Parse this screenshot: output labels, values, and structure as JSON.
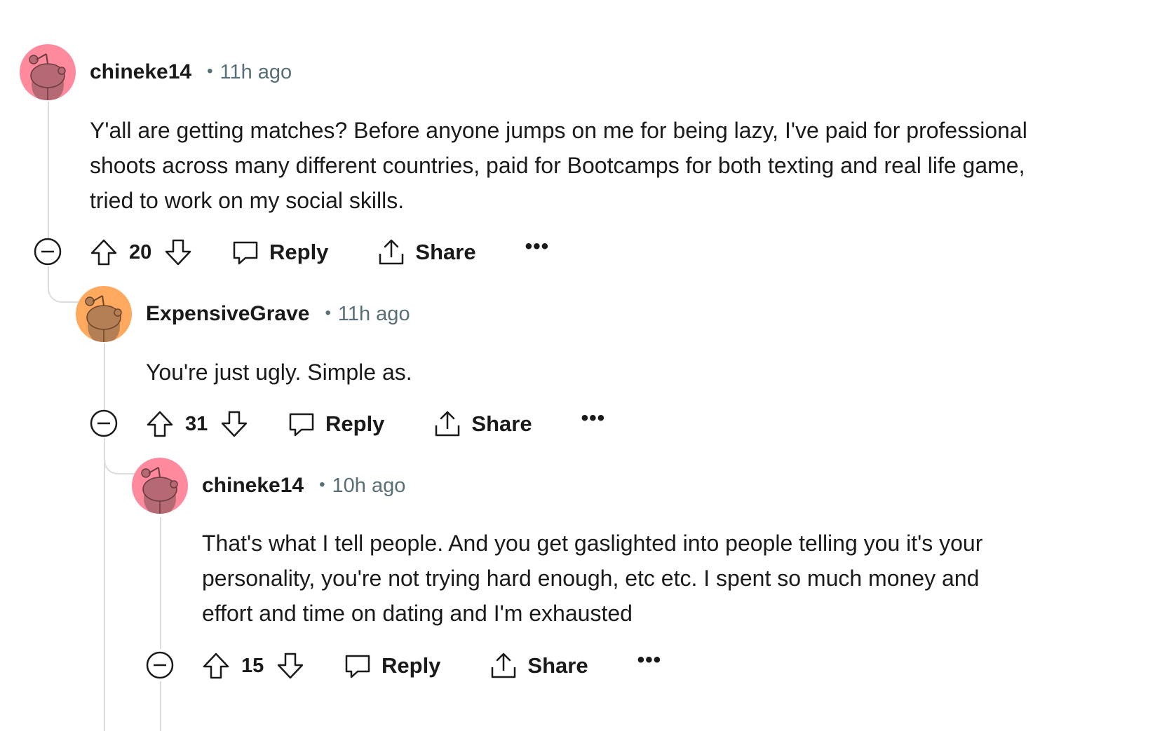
{
  "comments": [
    {
      "author": "chineke14",
      "time": "11h ago",
      "avatar_color": "#ff8a9e",
      "text": "Y'all are getting matches? Before anyone jumps on me for being lazy, I've paid for professional shoots across many different countries, paid for Bootcamps for both texting and real life game, tried to work on my social skills.",
      "score": "20",
      "reply_label": "Reply",
      "share_label": "Share",
      "more_label": "•••"
    },
    {
      "author": "ExpensiveGrave",
      "time": "11h ago",
      "avatar_color": "#ffa95e",
      "text": "You're just ugly. Simple as.",
      "score": "31",
      "reply_label": "Reply",
      "share_label": "Share",
      "more_label": "•••"
    },
    {
      "author": "chineke14",
      "time": "10h ago",
      "avatar_color": "#ff8a9e",
      "text": "That's what I tell people. And you get gaslighted into people telling you it's your personality, you're not trying hard enough, etc etc. I spent so much money and effort and time on dating and I'm exhausted",
      "score": "15",
      "reply_label": "Reply",
      "share_label": "Share",
      "more_label": "•••"
    }
  ],
  "separator": "•",
  "icons": {
    "collapse": "minus-circle-icon",
    "upvote": "arrow-up-icon",
    "downvote": "arrow-down-icon",
    "reply": "speech-bubble-icon",
    "share": "share-upload-icon",
    "avatar": "snoo-avatar-icon"
  }
}
